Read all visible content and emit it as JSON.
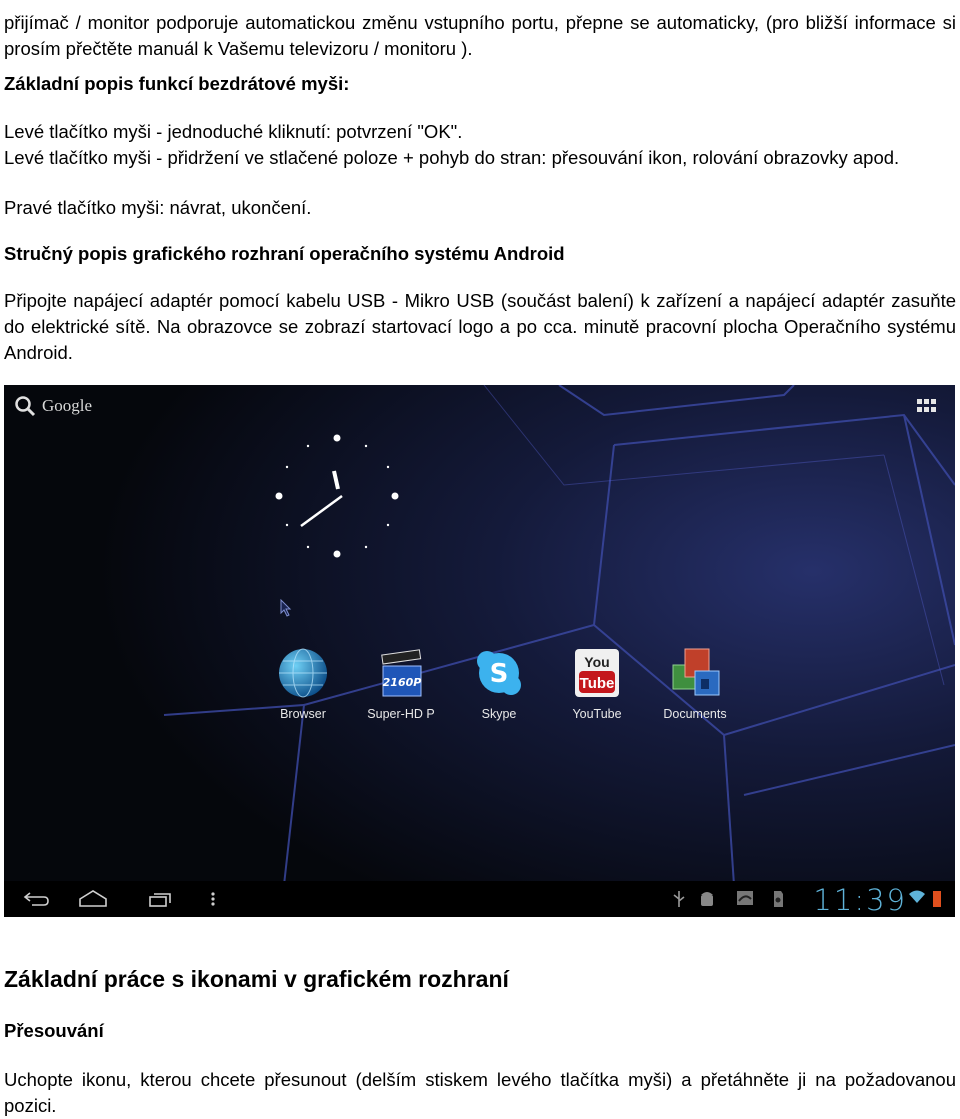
{
  "intro": {
    "line": "přijímač / monitor podporuje automatickou změnu vstupního portu, přepne se automaticky, (pro bližší informace si prosím přečtěte manuál k Vašemu televizoru / monitoru )."
  },
  "mouse_section": {
    "heading": "Základní popis funkcí bezdrátové myši:",
    "items": [
      "Levé tlačítko myši - jednoduché kliknutí: potvrzení \"OK\".",
      "Levé tlačítko myši - přidržení ve stlačené poloze + pohyb do stran: přesouvání ikon, rolování obrazovky apod.",
      "Pravé tlačítko myši: návrat, ukončení."
    ]
  },
  "android_section": {
    "heading": "Stručný popis grafického rozhraní operačního systému Android",
    "paragraph": "Připojte napájecí adaptér pomocí kabelu USB - Mikro USB (součást balení) k zařízení a napájecí adaptér zasuňte do elektrické sítě. Na obrazovce se zobrazí startovací logo a po cca. minutě pracovní plocha Operačního systému Android."
  },
  "screenshot": {
    "search_label": "Google",
    "clock_time": "11:39",
    "apps": [
      {
        "label": "Browser",
        "icon": "browser-globe-icon"
      },
      {
        "label": "Super-HD P",
        "icon": "clapperboard-2160p-icon"
      },
      {
        "label": "Skype",
        "icon": "skype-icon"
      },
      {
        "label": "YouTube",
        "icon": "youtube-icon"
      },
      {
        "label": "Documents",
        "icon": "documents-icon"
      }
    ],
    "clapper_text": "2160P",
    "youtube_top": "You",
    "youtube_bottom": "Tube",
    "skype_letter": "S",
    "colors": {
      "time": "#5fb3d9",
      "wifi": "#5fb3d9",
      "battery": "#e0501e"
    }
  },
  "icons_section": {
    "heading": "Základní práce s ikonami v grafickém rozhraní",
    "subheading": "Přesouvání",
    "paragraph": "Uchopte ikonu, kterou chcete přesunout (delším stiskem levého tlačítka myši) a přetáhněte ji na požadovanou pozici."
  }
}
